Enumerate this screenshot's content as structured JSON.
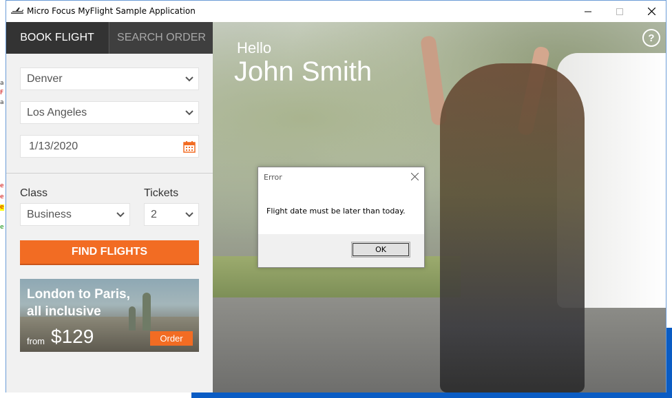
{
  "window": {
    "title": "Micro Focus MyFlight Sample Application",
    "controls": {
      "minimize": "—",
      "maximize": "☐",
      "close": "✕"
    }
  },
  "tabs": [
    {
      "label": "BOOK FLIGHT",
      "active": true
    },
    {
      "label": "SEARCH ORDER",
      "active": false
    }
  ],
  "form": {
    "from_city": "Denver",
    "to_city": "Los Angeles",
    "date": "1/13/2020",
    "class_label": "Class",
    "class_value": "Business",
    "tickets_label": "Tickets",
    "tickets_value": "2",
    "find_button": "FIND FLIGHTS"
  },
  "promo": {
    "line1": "London to Paris,",
    "line2": "all inclusive",
    "from": "from",
    "price": "$129",
    "order_button": "Order"
  },
  "greeting": {
    "hello": "Hello",
    "name": "John Smith",
    "help": "?"
  },
  "dialog": {
    "title": "Error",
    "message": "Flight date must be later than today.",
    "ok_button": "OK"
  },
  "colors": {
    "accent": "#f26c23",
    "tab_bar": "#333333",
    "panel": "#f1f1f1",
    "taskbar_blue": "#0a5cc4"
  }
}
